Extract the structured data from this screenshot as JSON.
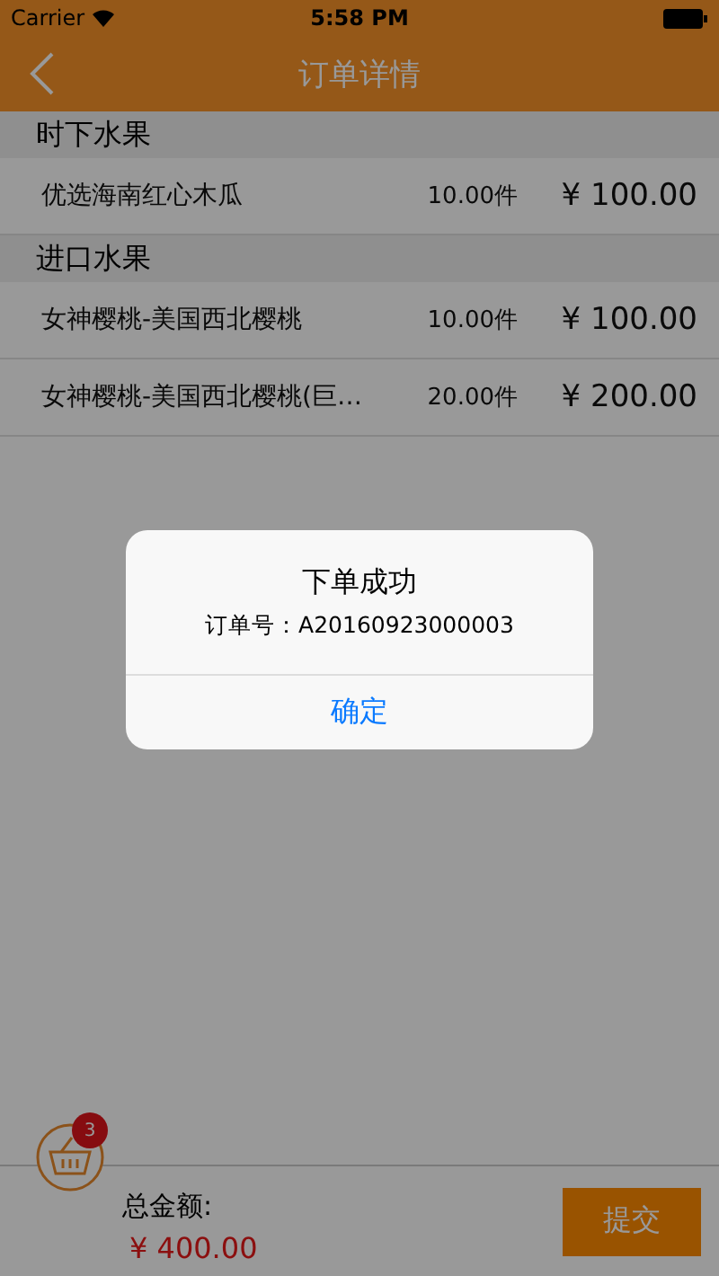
{
  "status_bar": {
    "carrier": "Carrier",
    "time": "5:58 PM"
  },
  "nav": {
    "title": "订单详情"
  },
  "sections": [
    {
      "title": "时下水果",
      "items": [
        {
          "name": "优选海南红心木瓜",
          "quantity": "10.00件",
          "price": "¥ 100.00"
        }
      ]
    },
    {
      "title": "进口水果",
      "items": [
        {
          "name": "女神樱桃-美国西北樱桃",
          "quantity": "10.00件",
          "price": "¥ 100.00"
        },
        {
          "name": "女神樱桃-美国西北樱桃(巨…",
          "quantity": "20.00件",
          "price": "¥ 200.00"
        }
      ]
    }
  ],
  "footer": {
    "cart_badge": "3",
    "total_label": "总金额:",
    "total": "¥ 400.00",
    "submit": "提交"
  },
  "alert": {
    "title": "下单成功",
    "message": "订单号：A20160923000003",
    "button": "确定"
  }
}
